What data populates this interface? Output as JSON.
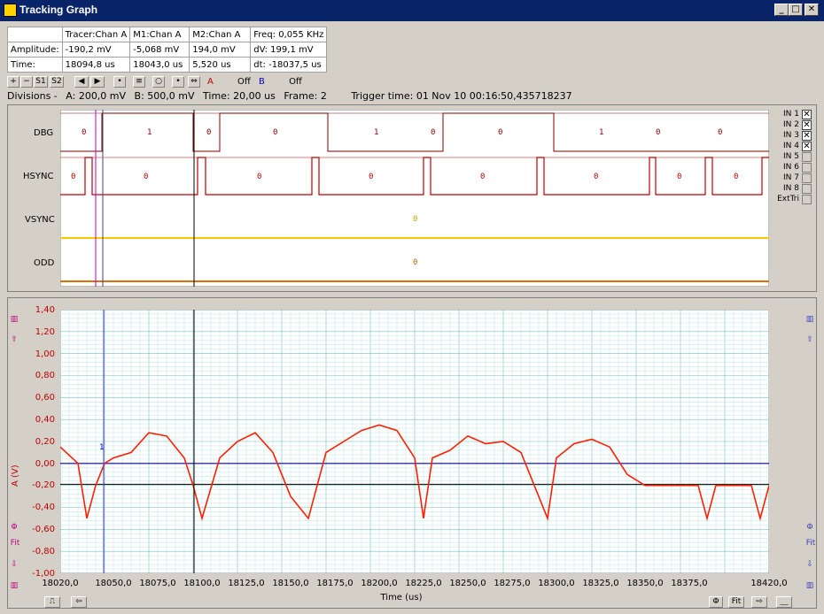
{
  "window": {
    "title": "Tracking Graph",
    "min": "_",
    "max": "□",
    "close": "✕"
  },
  "info": {
    "headers": [
      "",
      "Tracer:Chan A",
      "M1:Chan A",
      "M2:Chan A",
      "Freq: 0,055 KHz"
    ],
    "rows": [
      [
        "Amplitude:",
        "-190,2 mV",
        "-5,068 mV",
        "194,0 mV",
        "dV: 199,1 mV"
      ],
      [
        "Time:",
        "18094,8 us",
        "18043,0 us",
        "5,520 us",
        "dt: -18037,5 us"
      ]
    ]
  },
  "toolbar": {
    "s1": "S1",
    "s2": "S2",
    "a_label": "A",
    "a_state": "Off",
    "b_label": "B",
    "b_state": "Off"
  },
  "divisions": {
    "label": "Divisions -",
    "a": "A: 200,0 mV",
    "b": "B: 500,0 mV",
    "time": "Time: 20,00 us",
    "frame": "Frame: 2",
    "trigger": "Trigger time: 01 Nov 10 00:16:50,435718237"
  },
  "logic": {
    "channels": [
      "DBG",
      "HSYNC",
      "VSYNC",
      "ODD"
    ],
    "dbg_values": [
      "0",
      "1",
      "0",
      "0",
      "1",
      "0",
      "0",
      "1",
      "0",
      "0"
    ],
    "hsync_values": [
      "0",
      "0",
      "0",
      "0",
      "0",
      "0",
      "0",
      "0"
    ],
    "vsync_value": "0",
    "odd_value": "0",
    "inputs": [
      "IN 1",
      "IN 2",
      "IN 3",
      "IN 4",
      "IN 5",
      "IN 6",
      "IN 7",
      "IN 8",
      "ExtTri"
    ],
    "input_checked": [
      true,
      true,
      true,
      true,
      false,
      false,
      false,
      false,
      false
    ]
  },
  "analog": {
    "ylabel": "A (V)",
    "xlabel": "Time (us)",
    "yticks": [
      "1,40",
      "1,20",
      "1,00",
      "0,80",
      "0,60",
      "0,40",
      "0,20",
      "0,00",
      "-0,20",
      "-0,40",
      "-0,60",
      "-0,80",
      "-1,00"
    ],
    "xticks": [
      "18020,0",
      "18050,0",
      "18075,0",
      "18100,0",
      "18125,0",
      "18150,0",
      "18175,0",
      "18200,0",
      "18225,0",
      "18250,0",
      "18275,0",
      "18300,0",
      "18325,0",
      "18350,0",
      "18375,0",
      "18420,0"
    ],
    "marker_label": "1",
    "fit_label": "Fit",
    "trace_color": "#ff2000"
  },
  "chart_data": {
    "type": "line",
    "xlabel": "Time (us)",
    "ylabel": "A (V)",
    "xlim": [
      18020,
      18420
    ],
    "ylim": [
      -1.0,
      1.4
    ],
    "series": [
      {
        "x": [
          18020,
          18030,
          18035,
          18040,
          18045,
          18050,
          18060,
          18070,
          18080,
          18090,
          18095,
          18100,
          18110,
          18120,
          18130,
          18140,
          18150,
          18160,
          18170,
          18180,
          18190,
          18200,
          18210,
          18220,
          18225,
          18230,
          18240,
          18250,
          18260,
          18270,
          18280,
          18290,
          18295,
          18300,
          18310,
          18320,
          18330,
          18340,
          18350,
          18360,
          18370,
          18380,
          18385,
          18390,
          18400,
          18410,
          18415,
          18420
        ],
        "y": [
          0.15,
          0.0,
          -0.5,
          -0.2,
          0.0,
          0.05,
          0.1,
          0.28,
          0.25,
          0.05,
          -0.2,
          -0.5,
          0.05,
          0.2,
          0.28,
          0.1,
          -0.3,
          -0.5,
          0.1,
          0.2,
          0.3,
          0.35,
          0.3,
          0.05,
          -0.5,
          0.05,
          0.12,
          0.25,
          0.18,
          0.2,
          0.1,
          -0.3,
          -0.5,
          0.05,
          0.18,
          0.22,
          0.15,
          -0.1,
          -0.2,
          -0.2,
          -0.2,
          -0.2,
          -0.5,
          -0.2,
          -0.2,
          -0.2,
          -0.5,
          -0.2
        ]
      }
    ]
  }
}
